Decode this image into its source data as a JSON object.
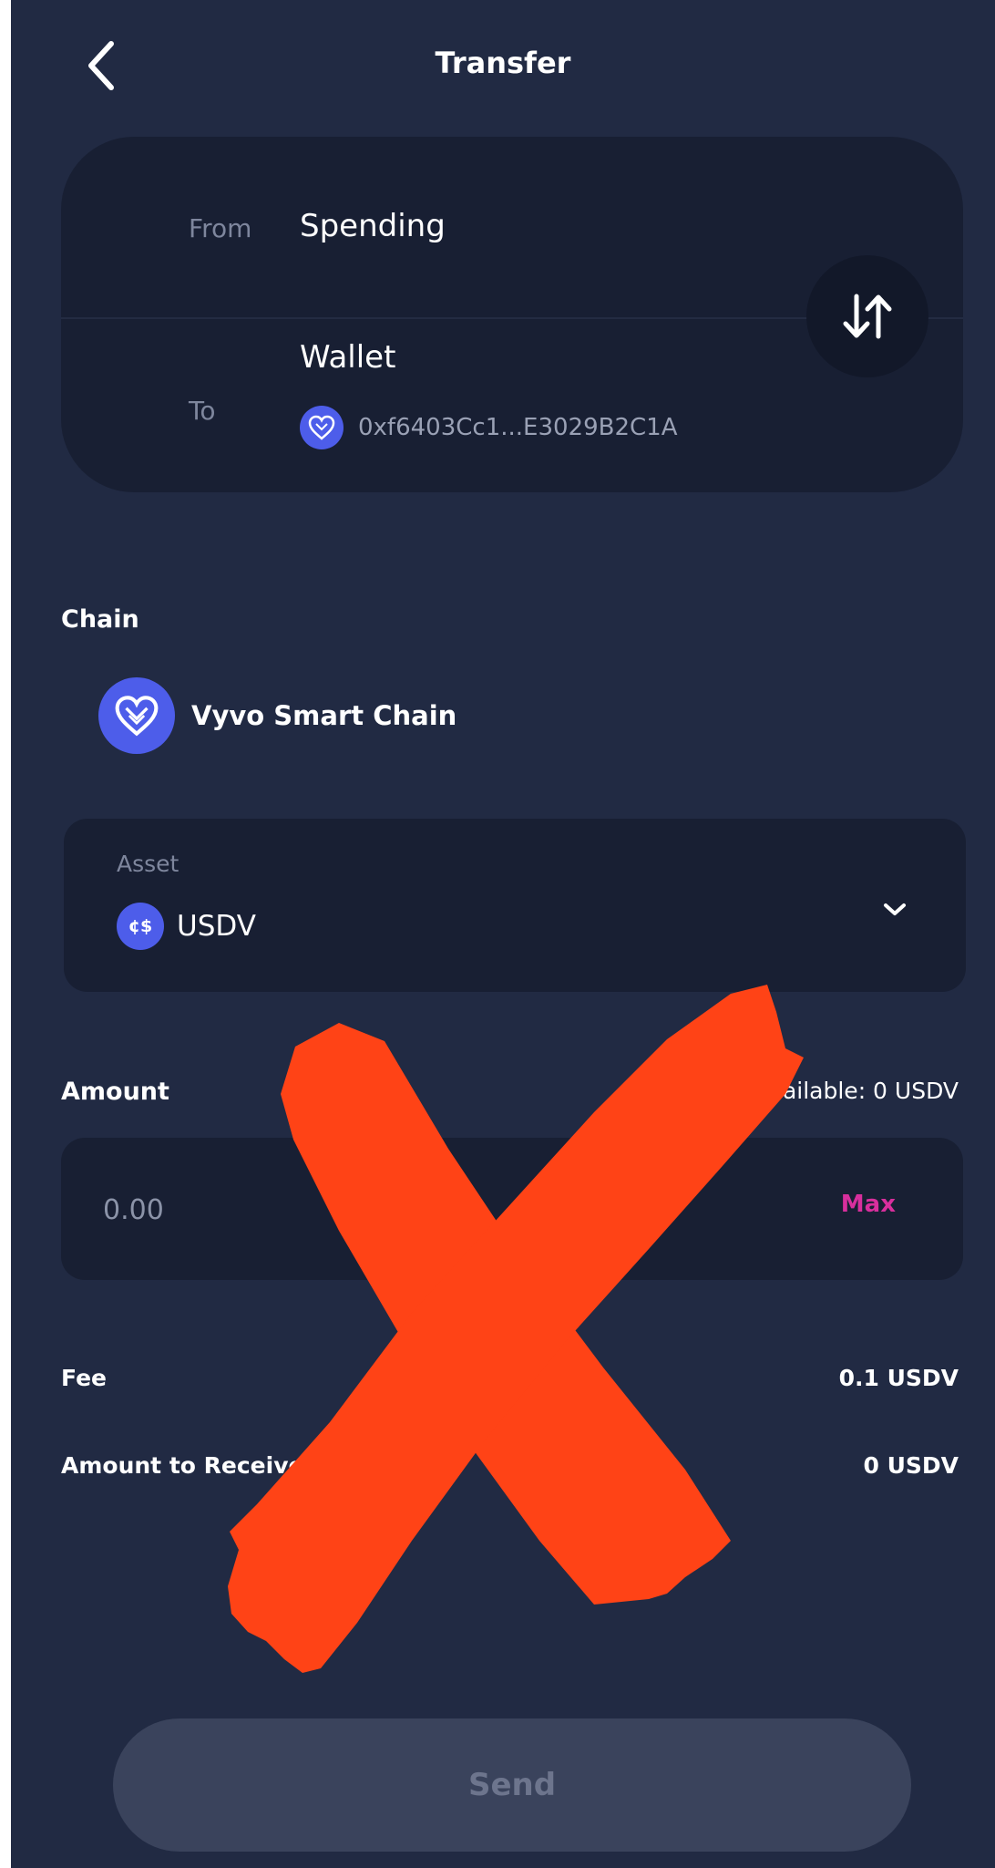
{
  "header": {
    "title": "Transfer",
    "back_icon": "chevron-left-icon"
  },
  "transfer": {
    "from_label": "From",
    "from_value": "Spending",
    "to_label": "To",
    "to_value": "Wallet",
    "address": "0xf6403Cc1...E3029B2C1A",
    "swap_icon": "swap-vertical-icon"
  },
  "chain": {
    "label": "Chain",
    "name": "Vyvo Smart Chain",
    "icon": "vyvo-heart-icon"
  },
  "asset": {
    "caption": "Asset",
    "icon_text": "¢$",
    "name": "USDV",
    "dropdown_icon": "chevron-down-icon"
  },
  "amount": {
    "label": "Amount",
    "available": "Available: 0 USDV",
    "placeholder": "0.00",
    "value": "",
    "max_label": "Max"
  },
  "fee": {
    "label": "Fee",
    "value": "0.1 USDV"
  },
  "receive": {
    "label": "Amount to Receive",
    "value": "0 USDV"
  },
  "send_button": {
    "label": "Send",
    "enabled": false
  },
  "overlay": {
    "icon": "red-cross-mark",
    "color": "#ff4316"
  },
  "colors": {
    "background": "#212a43",
    "card": "#181f33",
    "accent": "#4d5dea",
    "max": "#d82f9d"
  }
}
